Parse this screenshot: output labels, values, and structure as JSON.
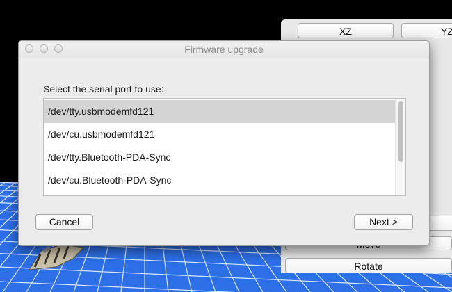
{
  "background_panel": {
    "buttons": [
      {
        "label": "XZ"
      },
      {
        "label": "YZ"
      },
      {
        "label": ""
      },
      {
        "label": "Move"
      },
      {
        "label": "Rotate"
      }
    ]
  },
  "dialog": {
    "title": "Firmware upgrade",
    "prompt": "Select the serial port to use:",
    "ports": [
      {
        "label": "/dev/tty.usbmodemfd121",
        "selected": true
      },
      {
        "label": "/dev/cu.usbmodemfd121",
        "selected": false
      },
      {
        "label": "/dev/tty.Bluetooth-PDA-Sync",
        "selected": false
      },
      {
        "label": "/dev/cu.Bluetooth-PDA-Sync",
        "selected": false
      }
    ],
    "cancel_label": "Cancel",
    "next_label": "Next >"
  },
  "colors": {
    "grid_background": "#2d6fe6",
    "grid_lines": "#d9e8ff",
    "selection": "#d4d4d4"
  }
}
